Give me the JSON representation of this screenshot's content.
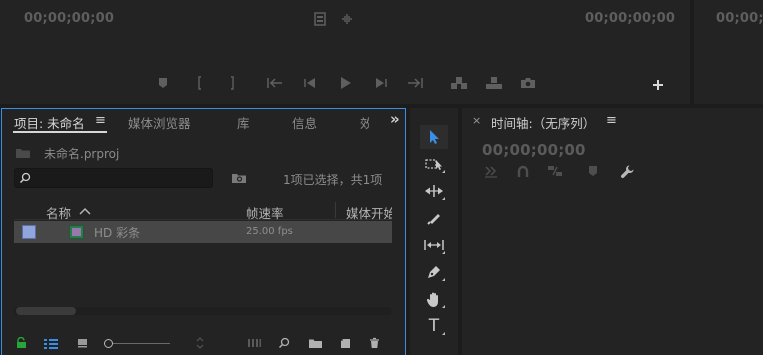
{
  "monitor_left": {
    "timecode_left": "00;00;00;00",
    "timecode_right": "00;00;00;00"
  },
  "monitor_right": {
    "timecode": "00;00;0"
  },
  "project_panel": {
    "tabs": [
      {
        "label": "项目: 未命名",
        "active": true
      },
      {
        "label": "媒体浏览器"
      },
      {
        "label": "库"
      },
      {
        "label": "信息"
      },
      {
        "label": "效"
      }
    ],
    "menu_glyph": "≡",
    "overflow_glyph": "»",
    "project_file": "未命名.prproj",
    "search": {
      "value": "",
      "placeholder": ""
    },
    "selection_status": "1项已选择，共1项",
    "columns": [
      {
        "label": "名称",
        "sort": "ascending"
      },
      {
        "label": "帧速率"
      },
      {
        "label": "媒体开始"
      }
    ],
    "rows": [
      {
        "name": "HD 彩条",
        "frame_rate": "25.00 fps",
        "label_color": "#8fa5dc",
        "icon_color": "#2c7a4c"
      }
    ]
  },
  "timeline_panel": {
    "title": "时间轴:（无序列）",
    "close_glyph": "×",
    "menu_glyph": "≡",
    "timecode": "00;00;00;00"
  },
  "tools": [
    {
      "name": "selection-tool",
      "active": true
    },
    {
      "name": "track-select-tool"
    },
    {
      "name": "ripple-edit-tool"
    },
    {
      "name": "razor-tool"
    },
    {
      "name": "slip-tool"
    },
    {
      "name": "pen-tool"
    },
    {
      "name": "hand-tool"
    },
    {
      "name": "type-tool",
      "glyph": "T"
    }
  ],
  "colors": {
    "accent": "#3a8ee6",
    "panel_bg": "#232323",
    "app_bg": "#1c1c1c",
    "new_bin_lock": "#28a53a"
  }
}
